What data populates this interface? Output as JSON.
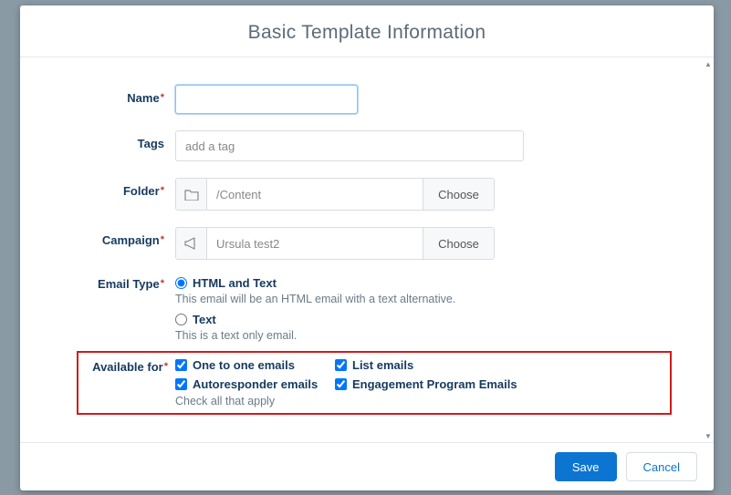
{
  "modal": {
    "title": "Basic Template Information"
  },
  "form": {
    "name": {
      "label": "Name",
      "value": ""
    },
    "tags": {
      "label": "Tags",
      "placeholder": "add a tag"
    },
    "folder": {
      "label": "Folder",
      "value": "/Content",
      "button": "Choose"
    },
    "campaign": {
      "label": "Campaign",
      "value": "Ursula test2",
      "button": "Choose"
    },
    "emailType": {
      "label": "Email Type",
      "options": [
        {
          "label": "HTML and Text",
          "help": "This email will be an HTML email with a text alternative.",
          "checked": true
        },
        {
          "label": "Text",
          "help": "This is a text only email.",
          "checked": false
        }
      ]
    },
    "availableFor": {
      "label": "Available for",
      "help": "Check all that apply",
      "options": [
        {
          "label": "One to one emails",
          "checked": true
        },
        {
          "label": "List emails",
          "checked": true
        },
        {
          "label": "Autoresponder emails",
          "checked": true
        },
        {
          "label": "Engagement Program Emails",
          "checked": true
        }
      ]
    }
  },
  "footer": {
    "save": "Save",
    "cancel": "Cancel"
  }
}
